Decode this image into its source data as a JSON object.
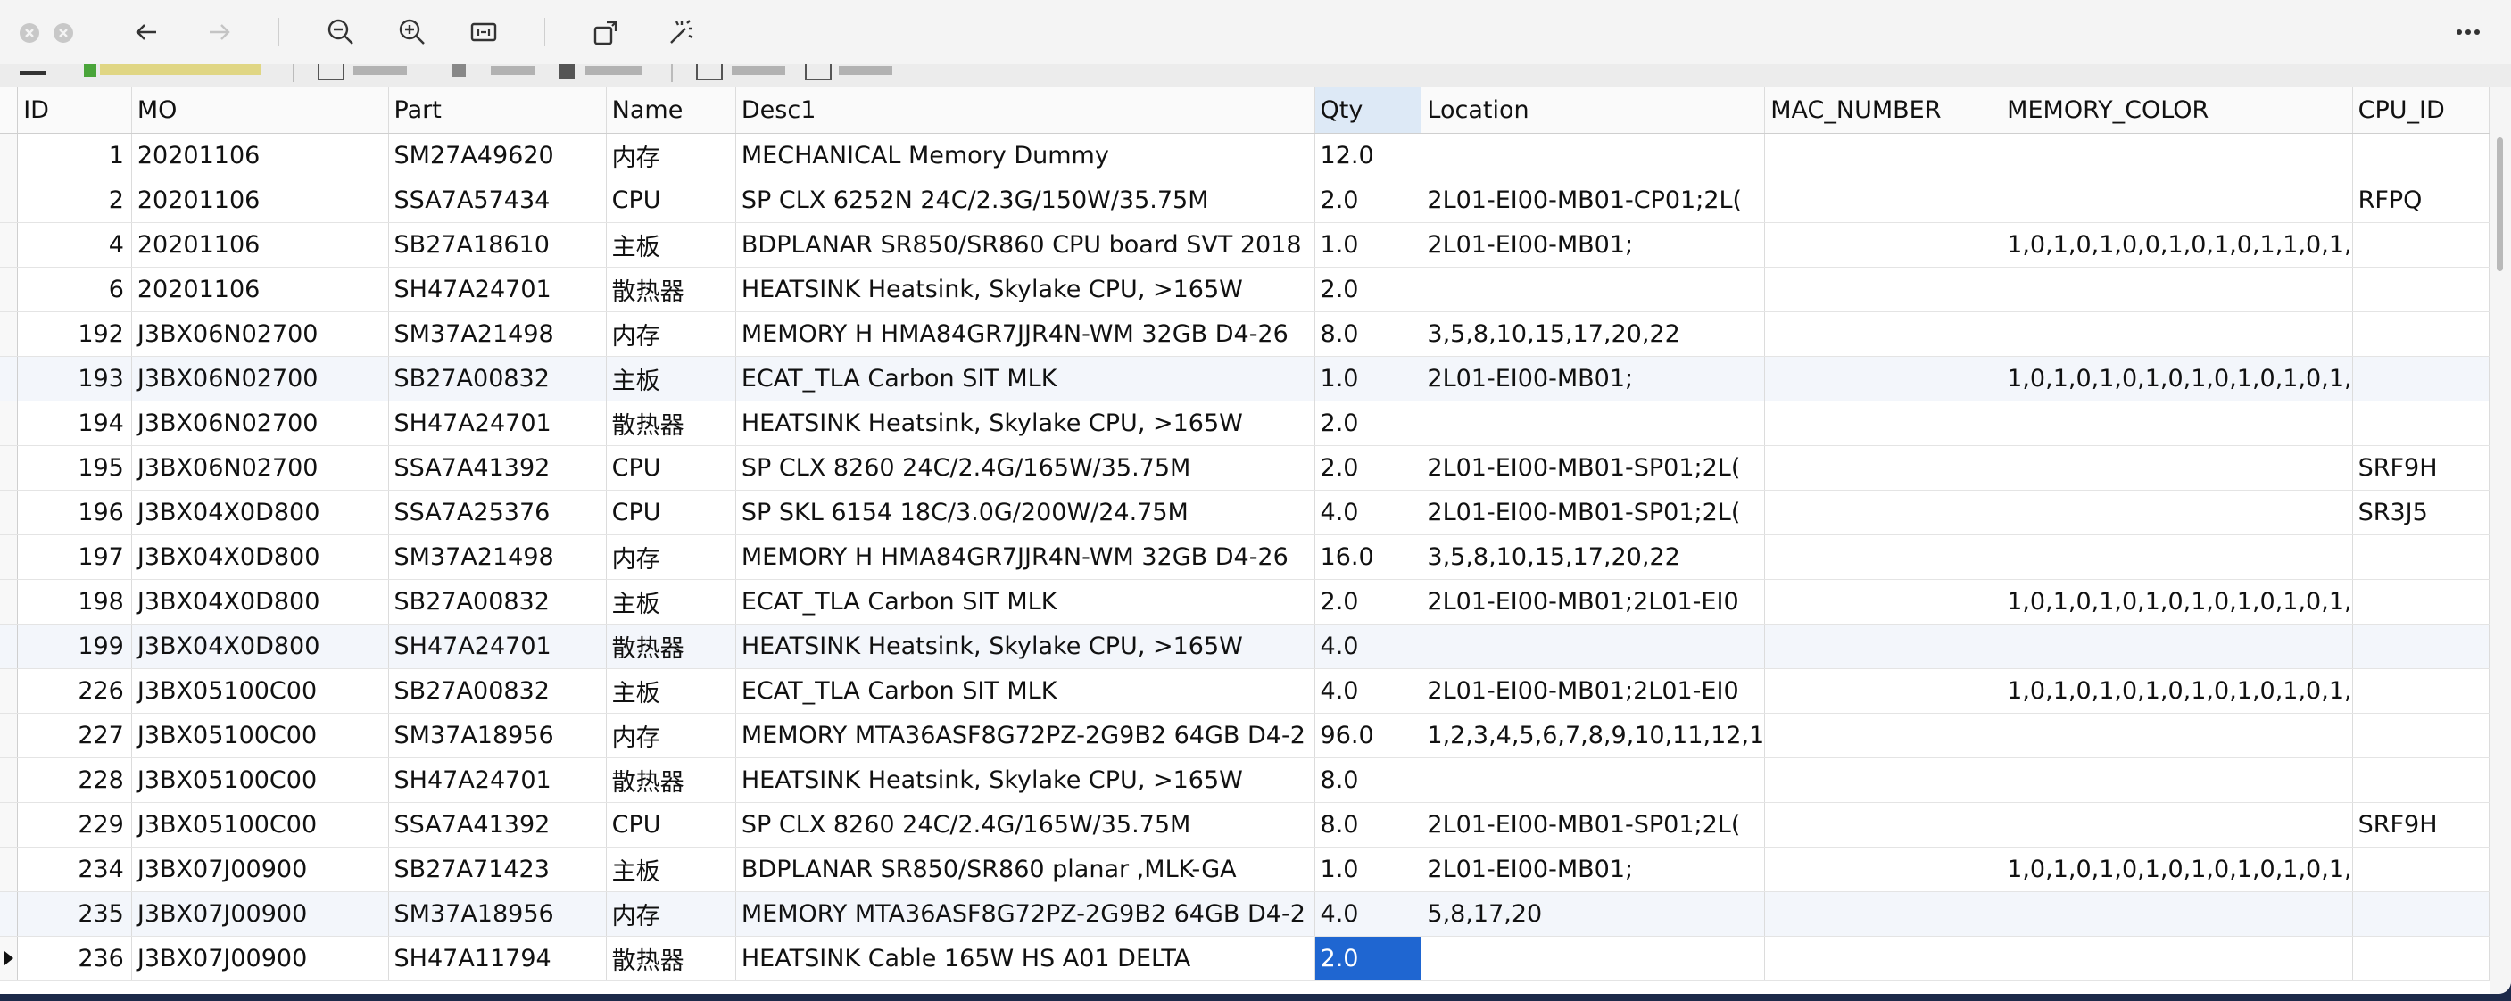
{
  "toolbar": {
    "icons": [
      "close-icon",
      "minimize-icon",
      "back-icon",
      "forward-icon",
      "zoom-out-icon",
      "zoom-in-icon",
      "fit-width-icon",
      "rotate-icon",
      "magic-wand-icon",
      "more-icon"
    ]
  },
  "colors": {
    "selected_cell": "#1f66d1",
    "header_selected": "#dde9f6",
    "alt_row": "#f3f6fb"
  },
  "grid": {
    "columns": [
      "ID",
      "MO",
      "Part",
      "Name",
      "Desc1",
      "Qty",
      "Location",
      "MAC_NUMBER",
      "MEMORY_COLOR",
      "CPU_ID"
    ],
    "rows": [
      [
        "1",
        "20201106",
        "SM27A49620",
        "内存",
        "MECHANICAL Memory Dummy",
        "12.0",
        "",
        "",
        "",
        ""
      ],
      [
        "2",
        "20201106",
        "SSA7A57434",
        "CPU",
        "SP CLX 6252N 24C/2.3G/150W/35.75M",
        "2.0",
        "2L01-EI00-MB01-CP01;2L(",
        "",
        "",
        "RFPQ"
      ],
      [
        "4",
        "20201106",
        "SB27A18610",
        "主板",
        "BDPLANAR SR850/SR860 CPU board SVT 2018",
        "1.0",
        "2L01-EI00-MB01;",
        "",
        "1,0,1,0,1,0,0,1,0,1,0,1,1,0,1,",
        ""
      ],
      [
        "6",
        "20201106",
        "SH47A24701",
        "散热器",
        "HEATSINK Heatsink, Skylake CPU, >165W",
        "2.0",
        "",
        "",
        "",
        ""
      ],
      [
        "192",
        "J3BX06N02700",
        "SM37A21498",
        "内存",
        "MEMORY H HMA84GR7JJR4N-WM 32GB D4-26",
        "8.0",
        "3,5,8,10,15,17,20,22",
        "",
        "",
        ""
      ],
      [
        "193",
        "J3BX06N02700",
        "SB27A00832",
        "主板",
        "ECAT_TLA Carbon SIT MLK",
        "1.0",
        "2L01-EI00-MB01;",
        "",
        "1,0,1,0,1,0,1,0,1,0,1,0,1,0,1,",
        ""
      ],
      [
        "194",
        "J3BX06N02700",
        "SH47A24701",
        "散热器",
        "HEATSINK Heatsink, Skylake CPU, >165W",
        "2.0",
        "",
        "",
        "",
        ""
      ],
      [
        "195",
        "J3BX06N02700",
        "SSA7A41392",
        "CPU",
        "SP CLX 8260 24C/2.4G/165W/35.75M",
        "2.0",
        "2L01-EI00-MB01-SP01;2L(",
        "",
        "",
        "SRF9H"
      ],
      [
        "196",
        "J3BX04X0D800",
        "SSA7A25376",
        "CPU",
        "SP SKL 6154 18C/3.0G/200W/24.75M",
        "4.0",
        "2L01-EI00-MB01-SP01;2L(",
        "",
        "",
        "SR3J5"
      ],
      [
        "197",
        "J3BX04X0D800",
        "SM37A21498",
        "内存",
        "MEMORY H HMA84GR7JJR4N-WM 32GB D4-26",
        "16.0",
        "3,5,8,10,15,17,20,22",
        "",
        "",
        ""
      ],
      [
        "198",
        "J3BX04X0D800",
        "SB27A00832",
        "主板",
        "ECAT_TLA Carbon SIT MLK",
        "2.0",
        "2L01-EI00-MB01;2L01-EI0",
        "",
        "1,0,1,0,1,0,1,0,1,0,1,0,1,0,1,",
        ""
      ],
      [
        "199",
        "J3BX04X0D800",
        "SH47A24701",
        "散热器",
        "HEATSINK Heatsink, Skylake CPU, >165W",
        "4.0",
        "",
        "",
        "",
        ""
      ],
      [
        "226",
        "J3BX05100C00",
        "SB27A00832",
        "主板",
        "ECAT_TLA Carbon SIT MLK",
        "4.0",
        "2L01-EI00-MB01;2L01-EI0",
        "",
        "1,0,1,0,1,0,1,0,1,0,1,0,1,0,1,",
        ""
      ],
      [
        "227",
        "J3BX05100C00",
        "SM37A18956",
        "内存",
        "MEMORY MTA36ASF8G72PZ-2G9B2 64GB D4-2",
        "96.0",
        "1,2,3,4,5,6,7,8,9,10,11,12,1",
        "",
        "",
        ""
      ],
      [
        "228",
        "J3BX05100C00",
        "SH47A24701",
        "散热器",
        "HEATSINK Heatsink, Skylake CPU, >165W",
        "8.0",
        "",
        "",
        "",
        ""
      ],
      [
        "229",
        "J3BX05100C00",
        "SSA7A41392",
        "CPU",
        "SP CLX 8260 24C/2.4G/165W/35.75M",
        "8.0",
        "2L01-EI00-MB01-SP01;2L(",
        "",
        "",
        "SRF9H"
      ],
      [
        "234",
        "J3BX07J00900",
        "SB27A71423",
        "主板",
        "BDPLANAR SR850/SR860  planar ,MLK-GA",
        "1.0",
        "2L01-EI00-MB01;",
        "",
        "1,0,1,0,1,0,1,0,1,0,1,0,1,0,1,",
        ""
      ],
      [
        "235",
        "J3BX07J00900",
        "SM37A18956",
        "内存",
        "MEMORY MTA36ASF8G72PZ-2G9B2 64GB D4-2",
        "4.0",
        "5,8,17,20",
        "",
        "",
        ""
      ],
      [
        "236",
        "J3BX07J00900",
        "SH47A11794",
        "散热器",
        "HEATSINK Cable 165W HS A01 DELTA",
        "2.0",
        "",
        "",
        "",
        ""
      ]
    ]
  }
}
